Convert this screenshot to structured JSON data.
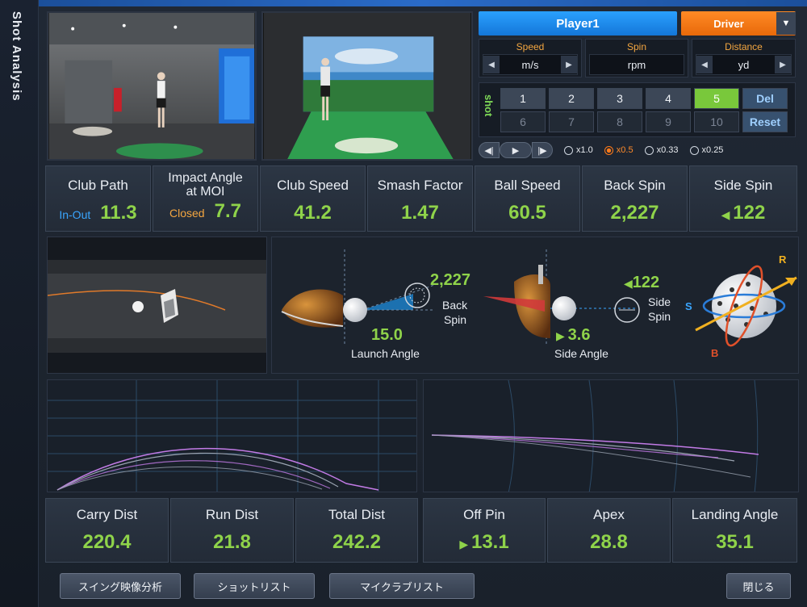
{
  "sidebar": {
    "title": "Shot Analysis"
  },
  "player": {
    "name": "Player1"
  },
  "club": {
    "selected": "Driver"
  },
  "units": {
    "speed": {
      "label": "Speed",
      "value": "m/s"
    },
    "spin": {
      "label": "Spin",
      "value": "rpm"
    },
    "distance": {
      "label": "Distance",
      "value": "yd"
    }
  },
  "shots": {
    "label": "shot",
    "row1": [
      "1",
      "2",
      "3",
      "4",
      "5"
    ],
    "row2": [
      "6",
      "7",
      "8",
      "9",
      "10"
    ],
    "active": "5",
    "del_label": "Del",
    "reset_label": "Reset"
  },
  "playback": {
    "speeds": [
      "x1.0",
      "x0.5",
      "x0.33",
      "x0.25"
    ],
    "selected": "x0.5"
  },
  "metrics_top": {
    "club_path": {
      "title": "Club Path",
      "dir": "In-Out",
      "value": "11.3"
    },
    "impact_angle": {
      "title": "Impact Angle",
      "subtitle": "at MOI",
      "dir": "Closed",
      "value": "7.7"
    },
    "club_speed": {
      "title": "Club Speed",
      "value": "41.2"
    },
    "smash_factor": {
      "title": "Smash Factor",
      "value": "1.47"
    },
    "ball_speed": {
      "title": "Ball Speed",
      "value": "60.5"
    },
    "back_spin": {
      "title": "Back Spin",
      "value": "2,227"
    },
    "side_spin": {
      "title": "Side Spin",
      "value": "122"
    }
  },
  "impact": {
    "back_spin_value": "2,227",
    "back_spin_label_1": "Back",
    "back_spin_label_2": "Spin",
    "launch_angle_value": "15.0",
    "launch_angle_label": "Launch Angle",
    "side_spin_value": "122",
    "side_spin_label_1": "Side",
    "side_spin_label_2": "Spin",
    "side_angle_value": "3.6",
    "side_angle_label": "Side Angle",
    "axis_r": "R",
    "axis_s": "S",
    "axis_b": "B"
  },
  "metrics_bottom": {
    "carry_dist": {
      "title": "Carry Dist",
      "value": "220.4"
    },
    "run_dist": {
      "title": "Run Dist",
      "value": "21.8"
    },
    "total_dist": {
      "title": "Total Dist",
      "value": "242.2"
    },
    "off_pin": {
      "title": "Off Pin",
      "value": "13.1"
    },
    "apex": {
      "title": "Apex",
      "value": "28.8"
    },
    "landing_angle": {
      "title": "Landing Angle",
      "value": "35.1"
    }
  },
  "buttons": {
    "swing_video": "スイング映像分析",
    "shot_list": "ショットリスト",
    "my_club_list": "マイクラブリスト",
    "close": "閉じる"
  },
  "colors": {
    "accent_green": "#8fd34a",
    "accent_blue": "#2aa0ff",
    "accent_orange": "#f4a640",
    "trajectory_purple": "#c27be6"
  }
}
